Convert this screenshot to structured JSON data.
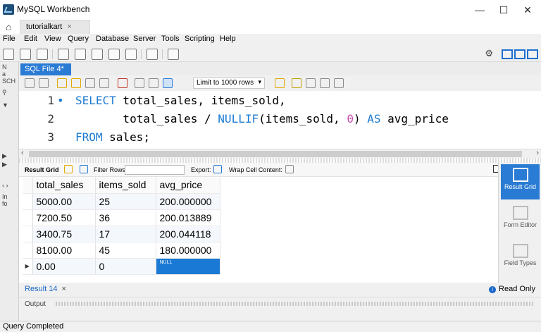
{
  "window": {
    "title": "MySQL Workbench",
    "minimize": "—",
    "maximize": "☐",
    "close": "✕"
  },
  "connection_tab": {
    "label": "tutorialkart",
    "close": "×"
  },
  "menu": [
    "File",
    "Edit",
    "View",
    "Query",
    "Database",
    "Server",
    "Tools",
    "Scripting",
    "Help"
  ],
  "editor_tab": {
    "label": "SQL File 4*",
    "close": "×"
  },
  "editor_toolbar": {
    "limit": "Limit to 1000 rows"
  },
  "editor": {
    "lines": [
      {
        "number": "1",
        "bullet": "•",
        "kw1": "SELECT",
        "text": " total_sales, items_sold,"
      },
      {
        "number": "2",
        "text_a": "       total_sales / ",
        "kw2": "NULLIF",
        "text_b": "(items_sold, ",
        "num": "0",
        "text_c": ") ",
        "kw3": "AS",
        "text_d": " avg_price"
      },
      {
        "number": "3",
        "kw1": "FROM",
        "text": " sales;"
      }
    ]
  },
  "result_toolbar": {
    "result_grid": "Result Grid",
    "filter_rows": "Filter Rows:",
    "export": "Export:",
    "wrap": "Wrap Cell Content:"
  },
  "grid": {
    "columns": [
      "total_sales",
      "items_sold",
      "avg_price"
    ],
    "rows": [
      [
        "5000.00",
        "25",
        "200.000000"
      ],
      [
        "7200.50",
        "36",
        "200.013889"
      ],
      [
        "3400.75",
        "17",
        "200.044118"
      ],
      [
        "8100.00",
        "45",
        "180.000000"
      ],
      [
        "0.00",
        "0",
        "NULL"
      ]
    ]
  },
  "side_panel": {
    "result_grid": "Result Grid",
    "form_editor": "Form Editor",
    "field_types": "Field Types"
  },
  "left_strip": {
    "n": "N",
    "a": "a",
    "sch": "SCH",
    "in": "In",
    "fo": "fo"
  },
  "result_tabs": {
    "tab": "Result 14",
    "close": "×",
    "read_only": "Read Only",
    "info": "i"
  },
  "output": {
    "label": "Output"
  },
  "status": {
    "text": "Query Completed"
  },
  "colors": {
    "accent": "#2a7bd4",
    "keyword": "#1c7bd1",
    "number": "#c94cb1",
    "null_cell": "#1a79d4"
  }
}
